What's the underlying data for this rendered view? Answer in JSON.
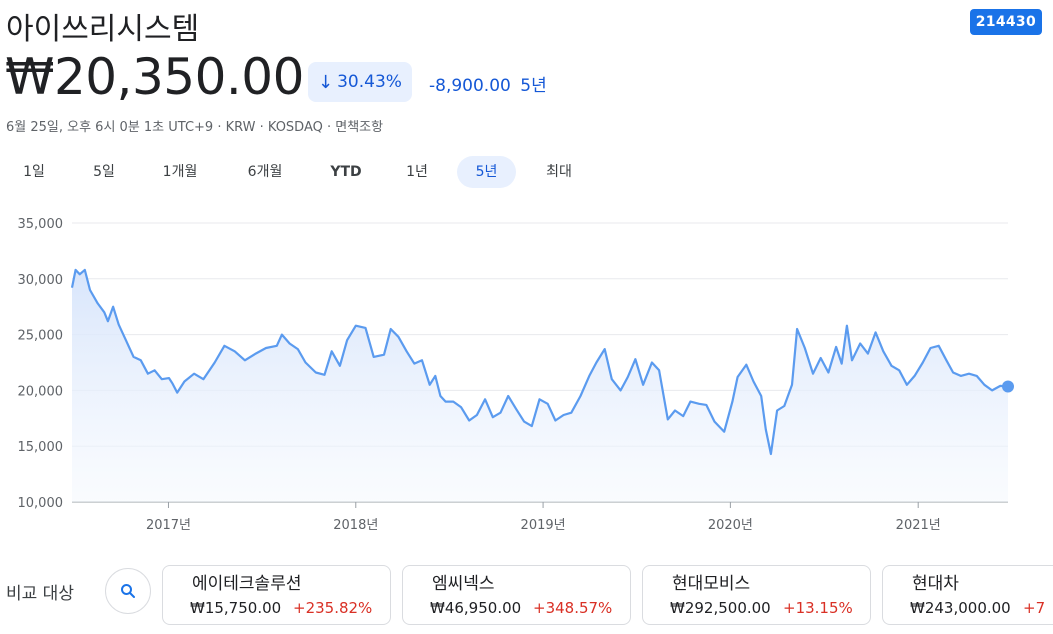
{
  "header": {
    "title": "아이쓰리시스템",
    "ticker": "214430",
    "price": "₩20,350.00",
    "change_pct": "30.43%",
    "change_abs": "-8,900.00",
    "change_period": "5년",
    "meta": "6월 25일, 오후 6시 0분 1초 UTC+9 · KRW · KOSDAQ · 면책조항",
    "accent_color": "#1a73e8",
    "negative_color": "#1558d6"
  },
  "range_tabs": [
    {
      "label": "1일",
      "active": false
    },
    {
      "label": "5일",
      "active": false
    },
    {
      "label": "1개월",
      "active": false
    },
    {
      "label": "6개월",
      "active": false
    },
    {
      "label": "YTD",
      "active": false
    },
    {
      "label": "1년",
      "active": false
    },
    {
      "label": "5년",
      "active": true
    },
    {
      "label": "최대",
      "active": false
    }
  ],
  "chart_data": {
    "type": "area",
    "title": "",
    "xlabel": "",
    "ylabel": "",
    "ylim": [
      10000,
      35000
    ],
    "yticks": [
      {
        "value": 35000,
        "label": "35,000"
      },
      {
        "value": 30000,
        "label": "30,000"
      },
      {
        "value": 25000,
        "label": "25,000"
      },
      {
        "value": 20000,
        "label": "20,000"
      },
      {
        "value": 15000,
        "label": "15,000"
      },
      {
        "value": 10000,
        "label": "10,000"
      }
    ],
    "xlim": [
      "2016-06-27",
      "2021-06-25"
    ],
    "xticks": [
      {
        "date": "2017-01-01",
        "label": "2017년"
      },
      {
        "date": "2018-01-01",
        "label": "2018년"
      },
      {
        "date": "2019-01-01",
        "label": "2019년"
      },
      {
        "date": "2020-01-01",
        "label": "2020년"
      },
      {
        "date": "2021-01-01",
        "label": "2021년"
      }
    ],
    "grid": true,
    "line_color": "#5b9bef",
    "series": [
      {
        "points": [
          [
            "2016-06-27",
            29200
          ],
          [
            "2016-07-04",
            30800
          ],
          [
            "2016-07-12",
            30400
          ],
          [
            "2016-07-22",
            30800
          ],
          [
            "2016-08-01",
            29000
          ],
          [
            "2016-08-16",
            27800
          ],
          [
            "2016-08-29",
            27000
          ],
          [
            "2016-09-05",
            26200
          ],
          [
            "2016-09-15",
            27500
          ],
          [
            "2016-09-26",
            25900
          ],
          [
            "2016-10-10",
            24500
          ],
          [
            "2016-10-25",
            23000
          ],
          [
            "2016-11-08",
            22700
          ],
          [
            "2016-11-22",
            21500
          ],
          [
            "2016-12-05",
            21800
          ],
          [
            "2016-12-19",
            21000
          ],
          [
            "2017-01-02",
            21100
          ],
          [
            "2017-01-09",
            20600
          ],
          [
            "2017-01-18",
            19800
          ],
          [
            "2017-02-01",
            20800
          ],
          [
            "2017-02-20",
            21500
          ],
          [
            "2017-03-10",
            21000
          ],
          [
            "2017-04-01",
            22500
          ],
          [
            "2017-04-20",
            24000
          ],
          [
            "2017-05-10",
            23500
          ],
          [
            "2017-05-30",
            22700
          ],
          [
            "2017-06-20",
            23300
          ],
          [
            "2017-07-10",
            23800
          ],
          [
            "2017-07-31",
            24000
          ],
          [
            "2017-08-10",
            25000
          ],
          [
            "2017-08-25",
            24200
          ],
          [
            "2017-09-10",
            23700
          ],
          [
            "2017-09-25",
            22500
          ],
          [
            "2017-10-15",
            21600
          ],
          [
            "2017-11-01",
            21400
          ],
          [
            "2017-11-15",
            23500
          ],
          [
            "2017-12-01",
            22200
          ],
          [
            "2017-12-15",
            24500
          ],
          [
            "2018-01-01",
            25800
          ],
          [
            "2018-01-20",
            25600
          ],
          [
            "2018-02-05",
            23000
          ],
          [
            "2018-02-25",
            23200
          ],
          [
            "2018-03-10",
            25500
          ],
          [
            "2018-03-25",
            24800
          ],
          [
            "2018-04-10",
            23500
          ],
          [
            "2018-04-25",
            22400
          ],
          [
            "2018-05-10",
            22700
          ],
          [
            "2018-05-25",
            20500
          ],
          [
            "2018-06-05",
            21300
          ],
          [
            "2018-06-15",
            19500
          ],
          [
            "2018-06-25",
            19000
          ],
          [
            "2018-07-10",
            19000
          ],
          [
            "2018-07-25",
            18500
          ],
          [
            "2018-08-10",
            17300
          ],
          [
            "2018-08-25",
            17800
          ],
          [
            "2018-09-10",
            19200
          ],
          [
            "2018-09-25",
            17600
          ],
          [
            "2018-10-10",
            18000
          ],
          [
            "2018-10-25",
            19500
          ],
          [
            "2018-11-10",
            18300
          ],
          [
            "2018-11-25",
            17200
          ],
          [
            "2018-12-10",
            16800
          ],
          [
            "2018-12-25",
            19200
          ],
          [
            "2019-01-10",
            18800
          ],
          [
            "2019-01-25",
            17300
          ],
          [
            "2019-02-10",
            17800
          ],
          [
            "2019-02-25",
            18000
          ],
          [
            "2019-03-15",
            19500
          ],
          [
            "2019-04-01",
            21300
          ],
          [
            "2019-04-15",
            22500
          ],
          [
            "2019-05-01",
            23700
          ],
          [
            "2019-05-15",
            21000
          ],
          [
            "2019-06-01",
            20000
          ],
          [
            "2019-06-15",
            21200
          ],
          [
            "2019-06-30",
            22800
          ],
          [
            "2019-07-15",
            20500
          ],
          [
            "2019-08-01",
            22500
          ],
          [
            "2019-08-15",
            21800
          ],
          [
            "2019-09-01",
            17400
          ],
          [
            "2019-09-15",
            18200
          ],
          [
            "2019-10-01",
            17700
          ],
          [
            "2019-10-15",
            19000
          ],
          [
            "2019-11-01",
            18800
          ],
          [
            "2019-11-15",
            18700
          ],
          [
            "2019-12-01",
            17200
          ],
          [
            "2019-12-20",
            16300
          ],
          [
            "2020-01-05",
            19000
          ],
          [
            "2020-01-15",
            21200
          ],
          [
            "2020-02-01",
            22300
          ],
          [
            "2020-02-15",
            20800
          ],
          [
            "2020-03-01",
            19500
          ],
          [
            "2020-03-10",
            16500
          ],
          [
            "2020-03-20",
            14300
          ],
          [
            "2020-04-01",
            18200
          ],
          [
            "2020-04-15",
            18600
          ],
          [
            "2020-04-30",
            20500
          ],
          [
            "2020-05-10",
            25500
          ],
          [
            "2020-05-25",
            23800
          ],
          [
            "2020-06-10",
            21500
          ],
          [
            "2020-06-25",
            22900
          ],
          [
            "2020-07-10",
            21600
          ],
          [
            "2020-07-25",
            23900
          ],
          [
            "2020-08-05",
            22400
          ],
          [
            "2020-08-15",
            25800
          ],
          [
            "2020-08-25",
            22700
          ],
          [
            "2020-09-10",
            24200
          ],
          [
            "2020-09-25",
            23300
          ],
          [
            "2020-10-10",
            25200
          ],
          [
            "2020-10-25",
            23500
          ],
          [
            "2020-11-10",
            22200
          ],
          [
            "2020-11-25",
            21800
          ],
          [
            "2020-12-10",
            20500
          ],
          [
            "2020-12-25",
            21300
          ],
          [
            "2021-01-10",
            22500
          ],
          [
            "2021-01-25",
            23800
          ],
          [
            "2021-02-10",
            24000
          ],
          [
            "2021-02-25",
            22700
          ],
          [
            "2021-03-10",
            21600
          ],
          [
            "2021-03-25",
            21300
          ],
          [
            "2021-04-10",
            21500
          ],
          [
            "2021-04-25",
            21300
          ],
          [
            "2021-05-10",
            20500
          ],
          [
            "2021-05-25",
            20000
          ],
          [
            "2021-06-10",
            20400
          ],
          [
            "2021-06-25",
            20350
          ]
        ]
      }
    ]
  },
  "compare": {
    "label": "비교 대상",
    "search_icon": "search-icon",
    "cards": [
      {
        "name": "에이테크솔루션",
        "price": "₩15,750.00",
        "change": "+235.82%"
      },
      {
        "name": "엠씨넥스",
        "price": "₩46,950.00",
        "change": "+348.57%"
      },
      {
        "name": "현대모비스",
        "price": "₩292,500.00",
        "change": "+13.15%"
      },
      {
        "name": "현대차",
        "price": "₩243,000.00",
        "change": "+7"
      }
    ],
    "positive_color": "#d93025"
  }
}
